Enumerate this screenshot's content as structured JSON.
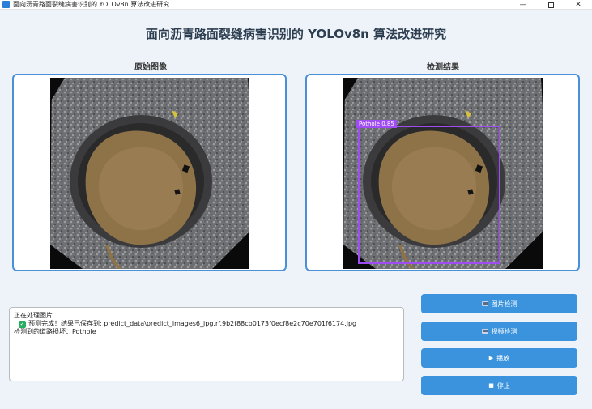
{
  "window": {
    "title": "面向沥青路面裂缝病害识别的 YOLOv8n 算法改进研究",
    "controls": {
      "minimize": "—",
      "maximize": "",
      "close": "✕"
    }
  },
  "header": {
    "title": "面向沥青路面裂缝病害识别的 YOLOv8n 算法改进研究"
  },
  "panels": {
    "original": {
      "label": "原始图像"
    },
    "result": {
      "label": "检测结果",
      "detection_label": "Pothole  0.85",
      "confidence": 0.85
    }
  },
  "log": {
    "lines": [
      "正在处理图片...",
      "预测完成！结果已保存到: predict_data\\predict_images6_jpg.rf.9b2f88cb0173f0ecf8e2c70e701f6174.jpg",
      "检测到的道路损坏：Pothole"
    ]
  },
  "buttons": {
    "image_detect": "图片检测",
    "video_detect": "视频检测",
    "play": "播放",
    "stop": "停止"
  },
  "icons": {
    "image_detect": "picture-icon",
    "video_detect": "video-icon",
    "play": "play-icon",
    "stop": "stop-icon",
    "check": "check-icon"
  },
  "colors": {
    "accent": "#3a93dc",
    "panel_border": "#4a90d9",
    "detection_box": "#a04cf5",
    "success": "#27ae60"
  }
}
